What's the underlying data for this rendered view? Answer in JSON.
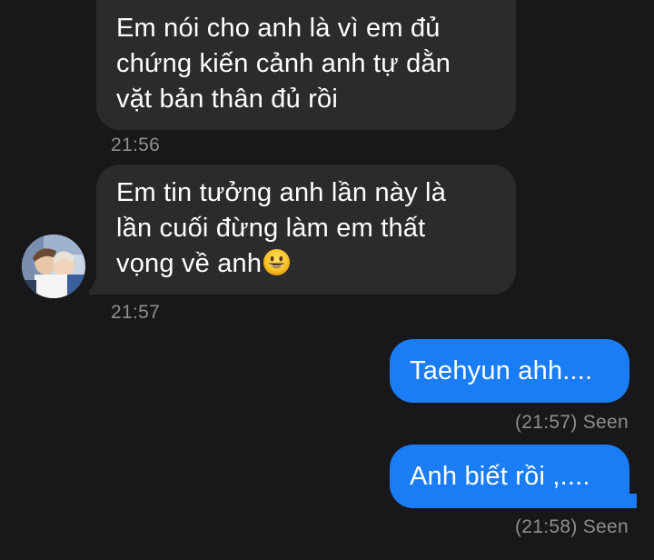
{
  "messages": [
    {
      "direction": "incoming",
      "lines": [
        "Em nói cho anh là vì em đủ",
        "chứng kiến cảnh anh tự dằn",
        "vặt bản thân đủ rồi"
      ],
      "time": "21:56"
    },
    {
      "direction": "incoming",
      "lines": [
        "Em tin tưởng anh lần này là",
        "lần cuối đừng làm em thất",
        "vọng về anh"
      ],
      "emoji": "grinning-face",
      "time": "21:57"
    },
    {
      "direction": "outgoing",
      "text": "Taehyun ahh....",
      "status": "(21:57) Seen"
    },
    {
      "direction": "outgoing",
      "text": "Anh biết rồi ,....",
      "status": "(21:58) Seen"
    }
  ],
  "colors": {
    "background": "#18181a",
    "incoming_bubble": "#2b2b2d",
    "outgoing_bubble": "#1a7df6",
    "timestamp": "#8e8e93"
  }
}
